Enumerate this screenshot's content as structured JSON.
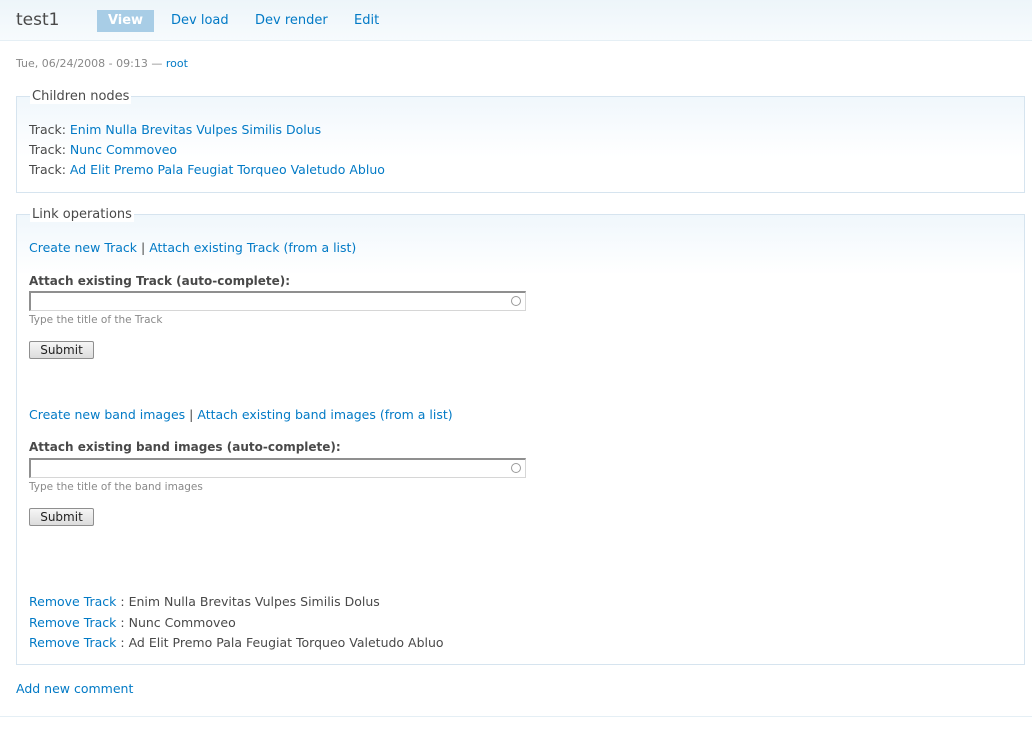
{
  "page": {
    "title": "test1",
    "tabs": [
      "View",
      "Dev load",
      "Dev render",
      "Edit"
    ],
    "submitted": {
      "date": "Tue, 06/24/2008 - 09:13 — ",
      "author": "root"
    }
  },
  "children": {
    "legend": "Children nodes",
    "items": [
      {
        "prefix": "Track: ",
        "title": "Enim Nulla Brevitas Vulpes Similis Dolus"
      },
      {
        "prefix": "Track: ",
        "title": "Nunc Commoveo"
      },
      {
        "prefix": "Track: ",
        "title": "Ad Elit Premo Pala Feugiat Torqueo Valetudo Abluo"
      }
    ]
  },
  "links": {
    "legend": "Link operations",
    "separator": " | ",
    "track": {
      "create": "Create new Track",
      "attach_list": "Attach existing Track (from a list)",
      "label": "Attach existing Track (auto-complete):",
      "value": "",
      "description": "Type the title of the Track",
      "submit": "Submit"
    },
    "band": {
      "create": "Create new band images",
      "attach_list": "Attach existing band images (from a list)",
      "label": "Attach existing band images (auto-complete):",
      "value": "",
      "description": "Type the title of the band images",
      "submit": "Submit"
    },
    "remove_label": "Remove Track",
    "remove_sep": " : ",
    "remove_items": [
      "Enim Nulla Brevitas Vulpes Similis Dolus",
      "Nunc Commoveo",
      "Ad Elit Premo Pala Feugiat Torqueo Valetudo Abluo"
    ]
  },
  "footer": {
    "add_comment": "Add new comment"
  },
  "colors": {
    "link": "#027ac6",
    "tab_active_bg": "#a8cde6",
    "border": "#d6e4ef"
  }
}
